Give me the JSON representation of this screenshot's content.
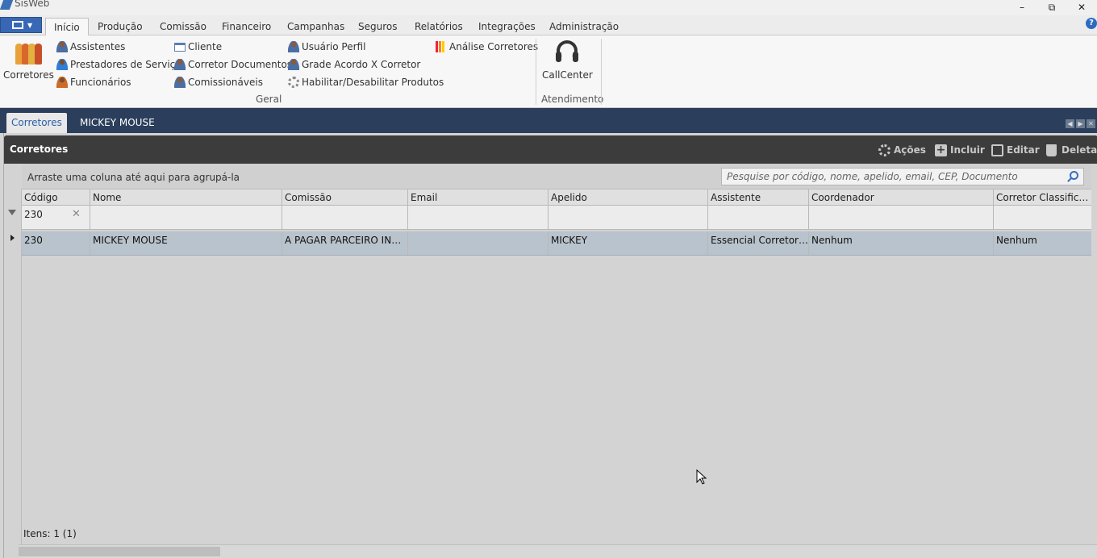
{
  "window": {
    "title": "SisWeb",
    "minimize": "–",
    "restore": "⧉",
    "close": "✕"
  },
  "menu": {
    "tabs": [
      "Início",
      "Produção",
      "Comissão",
      "Financeiro",
      "Campanhas",
      "Seguros",
      "Relatórios",
      "Integrações",
      "Administração"
    ],
    "help": "?"
  },
  "ribbon": {
    "corretores": "Corretores",
    "col1": [
      "Assistentes",
      "Prestadores de Serviço",
      "Funcionários"
    ],
    "col2": [
      "Cliente",
      "Corretor Documentos",
      "Comissionáveis"
    ],
    "col3": [
      "Usuário Perfil",
      "Grade Acordo X Corretor",
      "Habilitar/Desabilitar Produtos"
    ],
    "col4": [
      "Análise Corretores"
    ],
    "group_geral": "Geral",
    "callcenter": "CallCenter",
    "group_atendimento": "Atendimento"
  },
  "doc_tabs": [
    "Corretores",
    "MICKEY MOUSE"
  ],
  "panel": {
    "title": "Corretores",
    "actions": {
      "acoes": "Ações",
      "incluir": "Incluir",
      "editar": "Editar",
      "deletar": "Deletar"
    },
    "group_hint": "Arraste uma coluna até aqui para agrupá-la",
    "search_placeholder": "Pesquise por código, nome, apelido, email, CEP, Documento"
  },
  "grid": {
    "columns": [
      "Código",
      "Nome",
      "Comissão",
      "Email",
      "Apelido",
      "Assistente",
      "Coordenador",
      "Corretor Classificação"
    ],
    "filter": [
      "230",
      "",
      "",
      "",
      "",
      "",
      "",
      ""
    ],
    "rows": [
      [
        "230",
        "MICKEY MOUSE",
        "A PAGAR PARCEIRO INDICA",
        "",
        "MICKEY",
        "Essencial Corretora L...",
        "Nenhum",
        "Nenhum"
      ]
    ]
  },
  "footer": {
    "items": "Itens: 1 (1)"
  }
}
